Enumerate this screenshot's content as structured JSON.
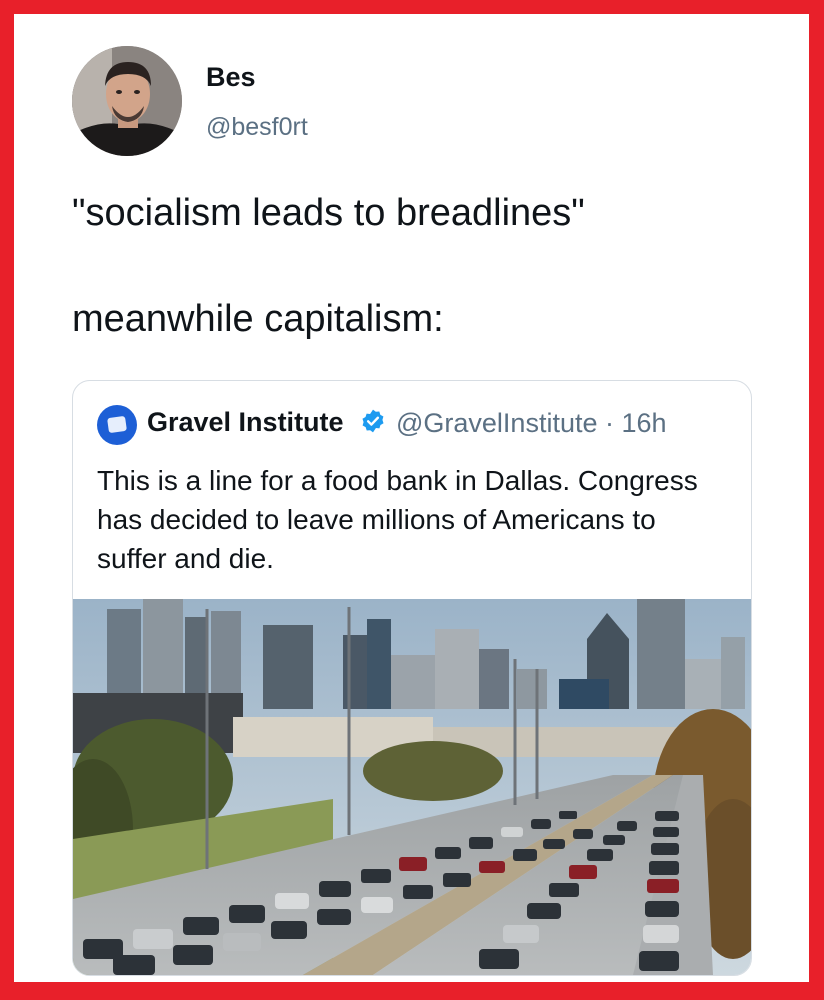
{
  "frame": {
    "border_color": "#e8202a"
  },
  "tweet": {
    "author_name": "Bes",
    "author_handle": "@besf0rt",
    "text_line1": "\"socialism leads to breadlines\"",
    "text_line2": "meanwhile capitalism:"
  },
  "quoted_tweet": {
    "author_name": "Gravel Institute",
    "verified": true,
    "handle_time": "@GravelInstitute · 16h",
    "text": "This is a line for a food bank in Dallas. Congress has decided to leave millions of Americans to suffer and die.",
    "logo_color": "#1d5fd6",
    "verified_color": "#1d9bf0"
  },
  "icons": {
    "avatar": "profile-photo",
    "logo": "gravel-institute-logo",
    "verified": "verified-badge-icon",
    "photo": "dallas-food-bank-car-line-photo"
  }
}
